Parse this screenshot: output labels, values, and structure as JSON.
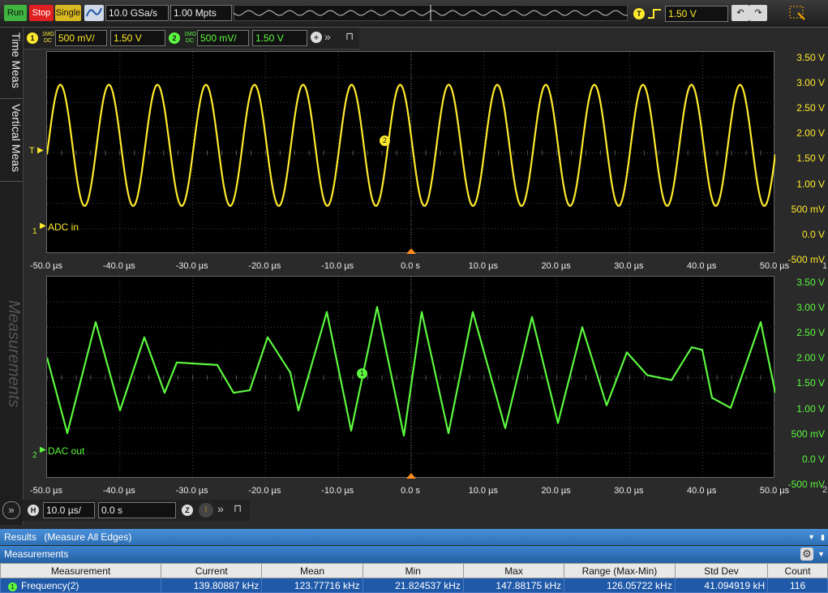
{
  "toolbar": {
    "run": "Run",
    "stop": "Stop",
    "single": "Single",
    "sample_rate": "10.0 GSa/s",
    "memory_depth": "1.00 Mpts",
    "trigger_badge": "T",
    "trigger_level": "1.50 V"
  },
  "channels": [
    {
      "badge": "1",
      "coupling_top": "1MΩ",
      "coupling_bottom": "DC",
      "scale": "500 mV/",
      "offset": "1.50 V",
      "color": "#ffea2e"
    },
    {
      "badge": "2",
      "coupling_top": "1MΩ",
      "coupling_bottom": "DC",
      "scale": "500 mV/",
      "offset": "1.50 V",
      "color": "#5cf83f"
    }
  ],
  "side_tabs": [
    "Time Meas",
    "Vertical Meas",
    "Measurements"
  ],
  "panes": [
    {
      "trace_label": "ADC in",
      "channel_marker": "2",
      "trigger_marker": "T",
      "ground_marker": "1",
      "color": "#ffea2e",
      "volt_labels": [
        "3.50 V",
        "3.00 V",
        "2.50 V",
        "2.00 V",
        "1.50 V",
        "1.00 V",
        "500 mV",
        "0.0 V",
        "-500 mV"
      ],
      "time_labels": [
        "-50.0 µs",
        "-40.0 µs",
        "-30.0 µs",
        "-20.0 µs",
        "-10.0 µs",
        "0.0 s",
        "10.0 µs",
        "20.0 µs",
        "30.0 µs",
        "40.0 µs",
        "50.0 µs"
      ],
      "right_edge_label": "1"
    },
    {
      "trace_label": "DAC out",
      "channel_marker": "1",
      "ground_marker": "2",
      "color": "#5cf83f",
      "volt_labels": [
        "3.50 V",
        "3.00 V",
        "2.50 V",
        "2.00 V",
        "1.50 V",
        "1.00 V",
        "500 mV",
        "0.0 V",
        "-500 mV"
      ],
      "time_labels": [
        "-50.0 µs",
        "-40.0 µs",
        "-30.0 µs",
        "-20.0 µs",
        "-10.0 µs",
        "0.0 s",
        "10.0 µs",
        "20.0 µs",
        "30.0 µs",
        "40.0 µs",
        "50.0 µs"
      ],
      "right_edge_label": "2"
    }
  ],
  "timebase": {
    "badge": "H",
    "scale": "10.0 µs/",
    "delay": "0.0 s",
    "zoom_badge": "Z"
  },
  "results": {
    "title": "Results",
    "subtitle": "(Measure All Edges)",
    "measurements_title": "Measurements",
    "columns": [
      "Measurement",
      "Current",
      "Mean",
      "Min",
      "Max",
      "Range (Max-Min)",
      "Std Dev",
      "Count"
    ],
    "rows": [
      {
        "badge": "1",
        "name": "Frequency(2)",
        "current": "139.80887 kHz",
        "mean": "123.77716 kHz",
        "min": "21.824537 kHz",
        "max": "147.88175 kHz",
        "range": "126.05722 kHz",
        "std_dev": "41.094919 kH",
        "count": "116"
      }
    ]
  }
}
